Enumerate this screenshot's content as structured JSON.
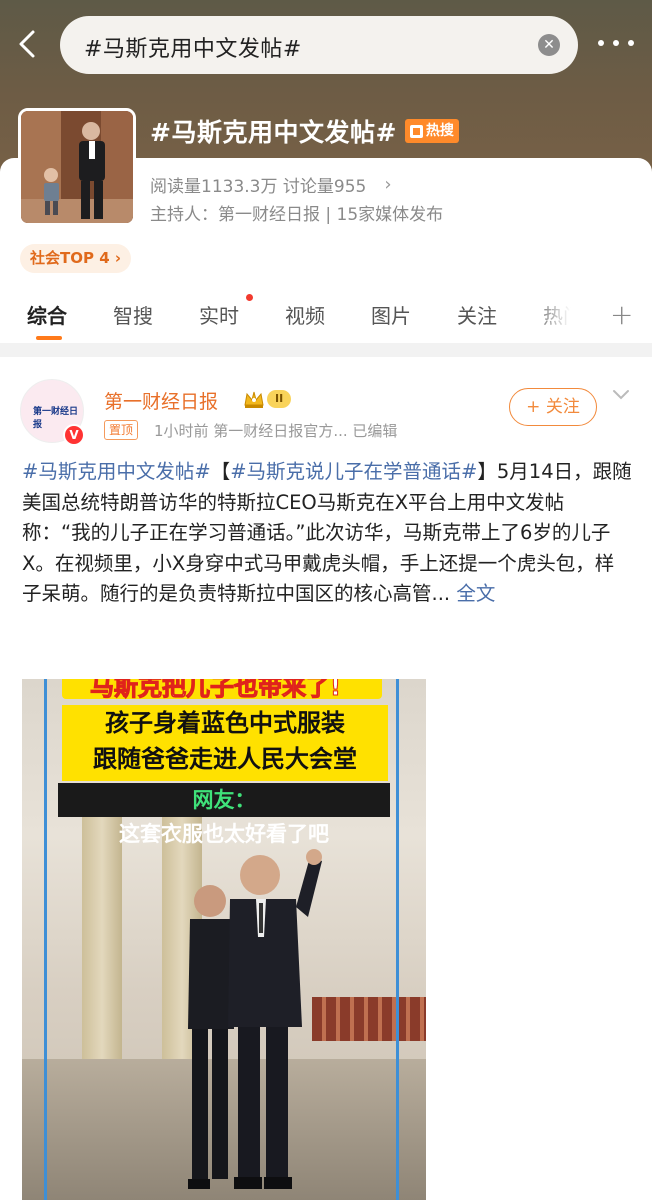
{
  "header": {
    "search_query": "#马斯克用中文发帖#",
    "topic_title": "#马斯克用中文发帖#",
    "hot_badge": "热搜",
    "stats": "阅读量1133.3万  讨论量955",
    "host": "主持人：第一财经日报 | 15家媒体发布",
    "rank_chip": "社会TOP 4 ›",
    "icons": [
      "back-icon",
      "clear-icon",
      "more-icon"
    ]
  },
  "tabs": [
    "综合",
    "智搜",
    "实时",
    "视频",
    "图片",
    "关注",
    "热门"
  ],
  "active_tab": "综合",
  "post": {
    "author": "第一财经日报",
    "level": "II",
    "pinned": "置顶",
    "meta": "1小时前  第一财经日报官方...  已编辑",
    "follow_label": "+ 关注",
    "avatar_text": "第一财经日报",
    "avatar_badge": "V",
    "text": {
      "tag1": "#马斯克用中文发帖#",
      "bracket_open": "【",
      "tag2": "#马斯克说儿子在学普通话#",
      "body": "】5月14日，跟随美国总统特朗普访华的特斯拉CEO马斯克在X平台上用中文发帖称：“我的儿子正在学习普通话。”此次访华，马斯克带上了6岁的儿子X。在视频里，小X身穿中式马甲戴虎头帽，手上还提一个虎头包，样子呆萌。随行的是负责特斯拉中国区的核心高管...",
      "more": "全文"
    },
    "video": {
      "caption_top": "马斯克把儿子也带来了!",
      "caption_line1": "孩子身着蓝色中式服装",
      "caption_line2": "跟随爸爸走进人民大会堂",
      "caption_dark_prefix": "网友：",
      "caption_dark_rest": "这套衣服也太好看了吧"
    }
  },
  "colors": {
    "accent": "#ff7a1a",
    "link": "#4a6ea9",
    "author": "#e8702a",
    "hot": "#ff8a2a"
  }
}
